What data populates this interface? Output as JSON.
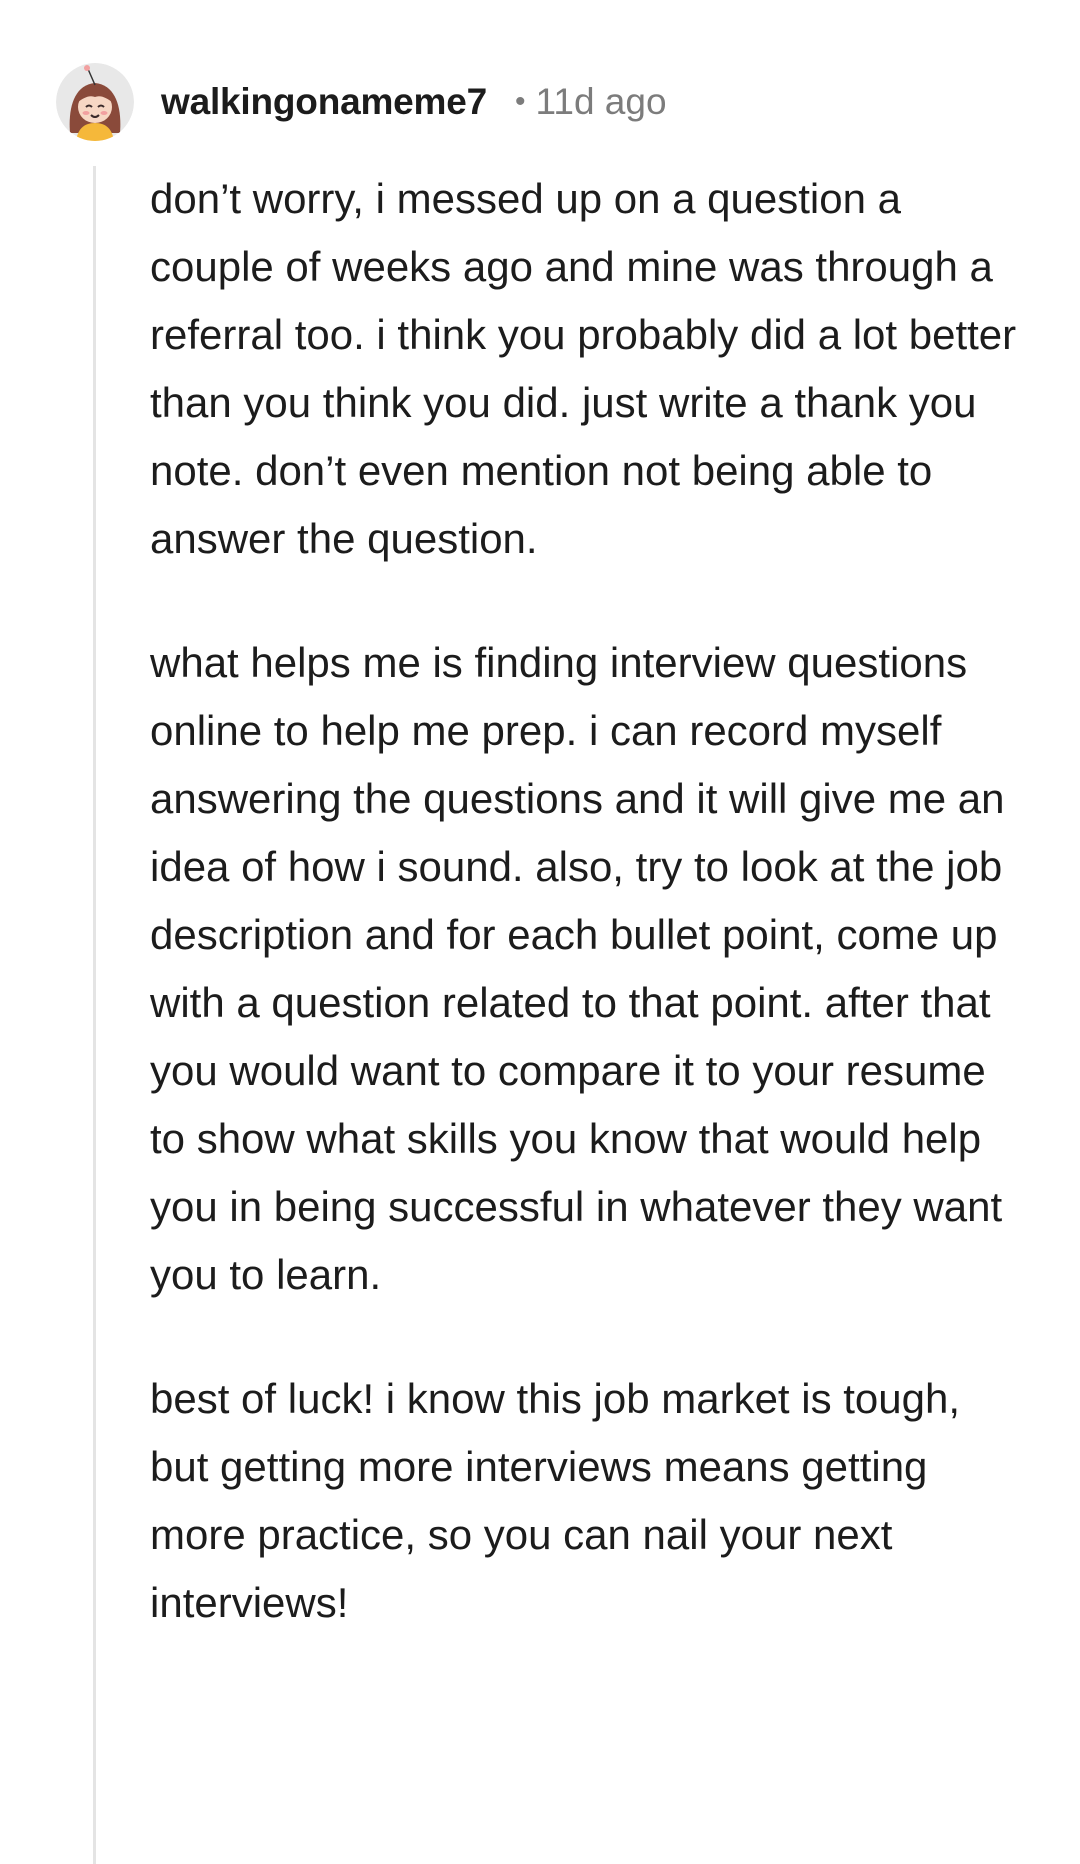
{
  "comment": {
    "author": "walkingonameme7",
    "separator": "•",
    "timestamp": "11d ago",
    "paragraphs": [
      "don’t worry, i messed up on a question a couple of weeks ago and mine was through a referral too. i think you probably did a lot better than you think you did. just write a thank you note. don’t even mention not being able to answer the question.",
      "what helps me is finding interview questions online to help me prep. i can record myself answering the questions and it will give me an idea of how i sound. also, try to look at the job description and for each bullet point, come up with a question related to that point. after that you would want to compare it to your resume to show what skills you know that would help you in being successful in whatever they want you to learn.",
      "best of luck! i know this job market is tough, but getting more interviews means getting more practice, so you can nail your next interviews!"
    ]
  },
  "colors": {
    "text": "#1c1c1c",
    "meta": "#7c7c7c",
    "thread_line": "#e4e4e4",
    "avatar_bg": "#e8e8e8"
  },
  "icons": {
    "avatar": "user-avatar-icon"
  }
}
